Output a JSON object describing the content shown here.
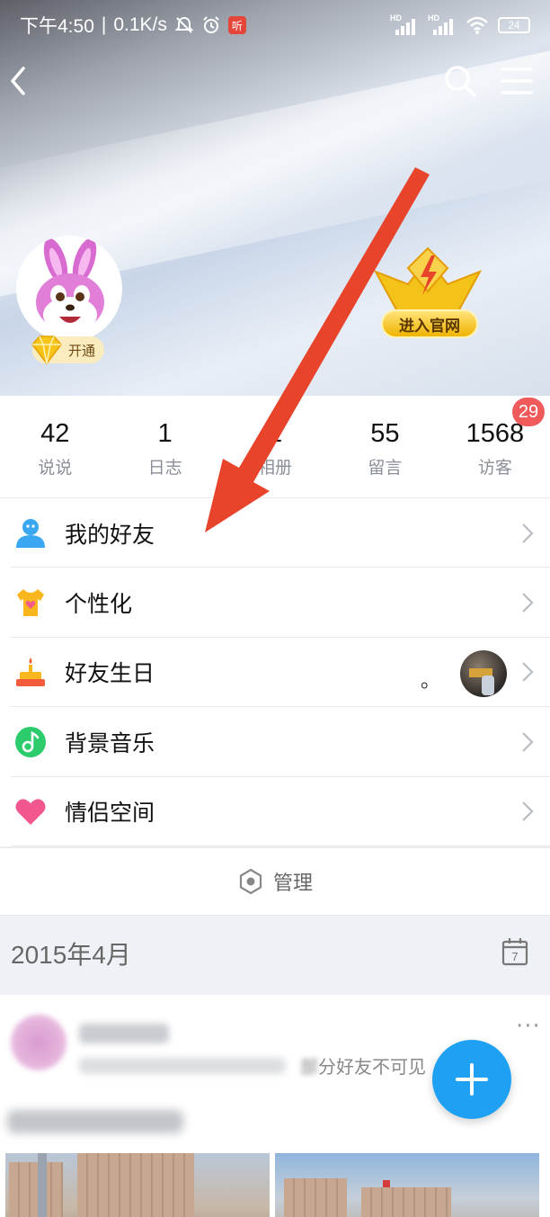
{
  "status_bar": {
    "time": "下午4:50",
    "speed": "0.1K/s",
    "listen_badge": "听",
    "battery": "24",
    "hd1": "HD",
    "hd2": "HD"
  },
  "header": {
    "vip_label": "开通",
    "official_label": "进入官网"
  },
  "stats": [
    {
      "value": "42",
      "label": "说说"
    },
    {
      "value": "1",
      "label": "日志"
    },
    {
      "value": "1",
      "label": "相册"
    },
    {
      "value": "55",
      "label": "留言"
    },
    {
      "value": "1568",
      "label": "访客",
      "badge": "29"
    }
  ],
  "menu": [
    {
      "label": "我的好友",
      "icon": "friends-icon"
    },
    {
      "label": "个性化",
      "icon": "tshirt-icon"
    },
    {
      "label": "好友生日",
      "icon": "cake-icon",
      "extra": "。"
    },
    {
      "label": "背景音乐",
      "icon": "music-icon"
    },
    {
      "label": "情侣空间",
      "icon": "heart-icon"
    }
  ],
  "manage_label": "管理",
  "section_date": "2015年4月",
  "calendar_day": "7",
  "feed": {
    "privacy_text": "分好友不可见",
    "more": "···"
  },
  "colors": {
    "accent": "#1ea1f3",
    "badge": "#f05a5a",
    "arrow": "#e8432b"
  }
}
